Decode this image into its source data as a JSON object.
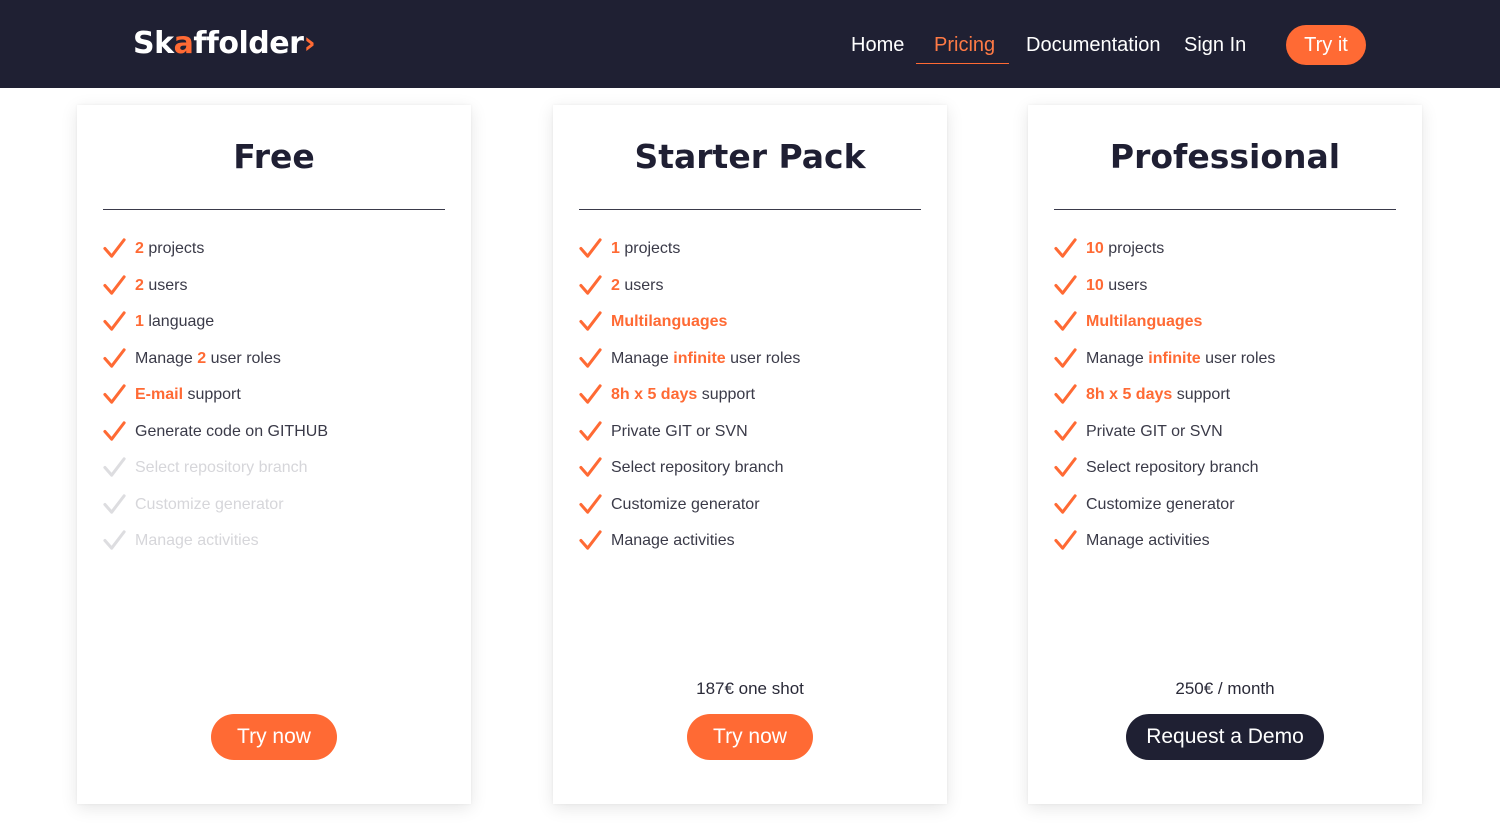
{
  "brand": {
    "name_main": "Sk",
    "name_accent_a": "a",
    "name_rest": "ffolder",
    "name_accent_end": "›",
    "accent_color": "#ff6a34",
    "nav_bg": "#1f2033"
  },
  "nav": {
    "links": [
      {
        "label": "Home",
        "active": false
      },
      {
        "label": "Pricing",
        "active": true
      },
      {
        "label": "Documentation",
        "active": false
      },
      {
        "label": "Sign In",
        "active": false
      }
    ],
    "cta_label": "Try it"
  },
  "plans": [
    {
      "title": "Free",
      "features": [
        {
          "hl": "2",
          "pre": "",
          "post": " projects",
          "enabled": true
        },
        {
          "hl": "2",
          "pre": "",
          "post": " users",
          "enabled": true
        },
        {
          "hl": "1",
          "pre": "",
          "post": " language",
          "enabled": true
        },
        {
          "hl": "2",
          "pre": "Manage ",
          "post": " user roles",
          "enabled": true
        },
        {
          "hl": "E-mail",
          "pre": "",
          "post": " support",
          "enabled": true
        },
        {
          "hl": "",
          "pre": "Generate code on GITHUB",
          "post": "",
          "enabled": true
        },
        {
          "hl": "",
          "pre": "Select repository branch",
          "post": "",
          "enabled": false
        },
        {
          "hl": "",
          "pre": "Customize generator",
          "post": "",
          "enabled": false
        },
        {
          "hl": "",
          "pre": "Manage activities",
          "post": "",
          "enabled": false
        }
      ],
      "price": "",
      "cta": "Try now",
      "cta_style": "orange"
    },
    {
      "title": "Starter Pack",
      "features": [
        {
          "hl": "1",
          "pre": "",
          "post": " projects",
          "enabled": true
        },
        {
          "hl": "2",
          "pre": "",
          "post": " users",
          "enabled": true
        },
        {
          "hl": "Multilanguages",
          "pre": "",
          "post": "",
          "enabled": true
        },
        {
          "hl": "infinite",
          "pre": "Manage ",
          "post": " user roles",
          "enabled": true
        },
        {
          "hl": "8h x 5 days",
          "pre": "",
          "post": " support",
          "enabled": true
        },
        {
          "hl": "",
          "pre": "Private GIT or SVN",
          "post": "",
          "enabled": true
        },
        {
          "hl": "",
          "pre": "Select repository branch",
          "post": "",
          "enabled": true
        },
        {
          "hl": "",
          "pre": "Customize generator",
          "post": "",
          "enabled": true
        },
        {
          "hl": "",
          "pre": "Manage activities",
          "post": "",
          "enabled": true
        }
      ],
      "price": "187€ one shot",
      "cta": "Try now",
      "cta_style": "orange"
    },
    {
      "title": "Professional",
      "features": [
        {
          "hl": "10",
          "pre": "",
          "post": " projects",
          "enabled": true
        },
        {
          "hl": "10",
          "pre": "",
          "post": " users",
          "enabled": true
        },
        {
          "hl": "Multilanguages",
          "pre": "",
          "post": "",
          "enabled": true
        },
        {
          "hl": "infinite",
          "pre": "Manage ",
          "post": " user roles",
          "enabled": true
        },
        {
          "hl": "8h x 5 days",
          "pre": "",
          "post": " support",
          "enabled": true
        },
        {
          "hl": "",
          "pre": "Private GIT or SVN",
          "post": "",
          "enabled": true
        },
        {
          "hl": "",
          "pre": "Select repository branch",
          "post": "",
          "enabled": true
        },
        {
          "hl": "",
          "pre": "Customize generator",
          "post": "",
          "enabled": true
        },
        {
          "hl": "",
          "pre": "Manage activities",
          "post": "",
          "enabled": true
        }
      ],
      "price": "250€ / month",
      "cta": "Request a Demo",
      "cta_style": "dark"
    }
  ]
}
